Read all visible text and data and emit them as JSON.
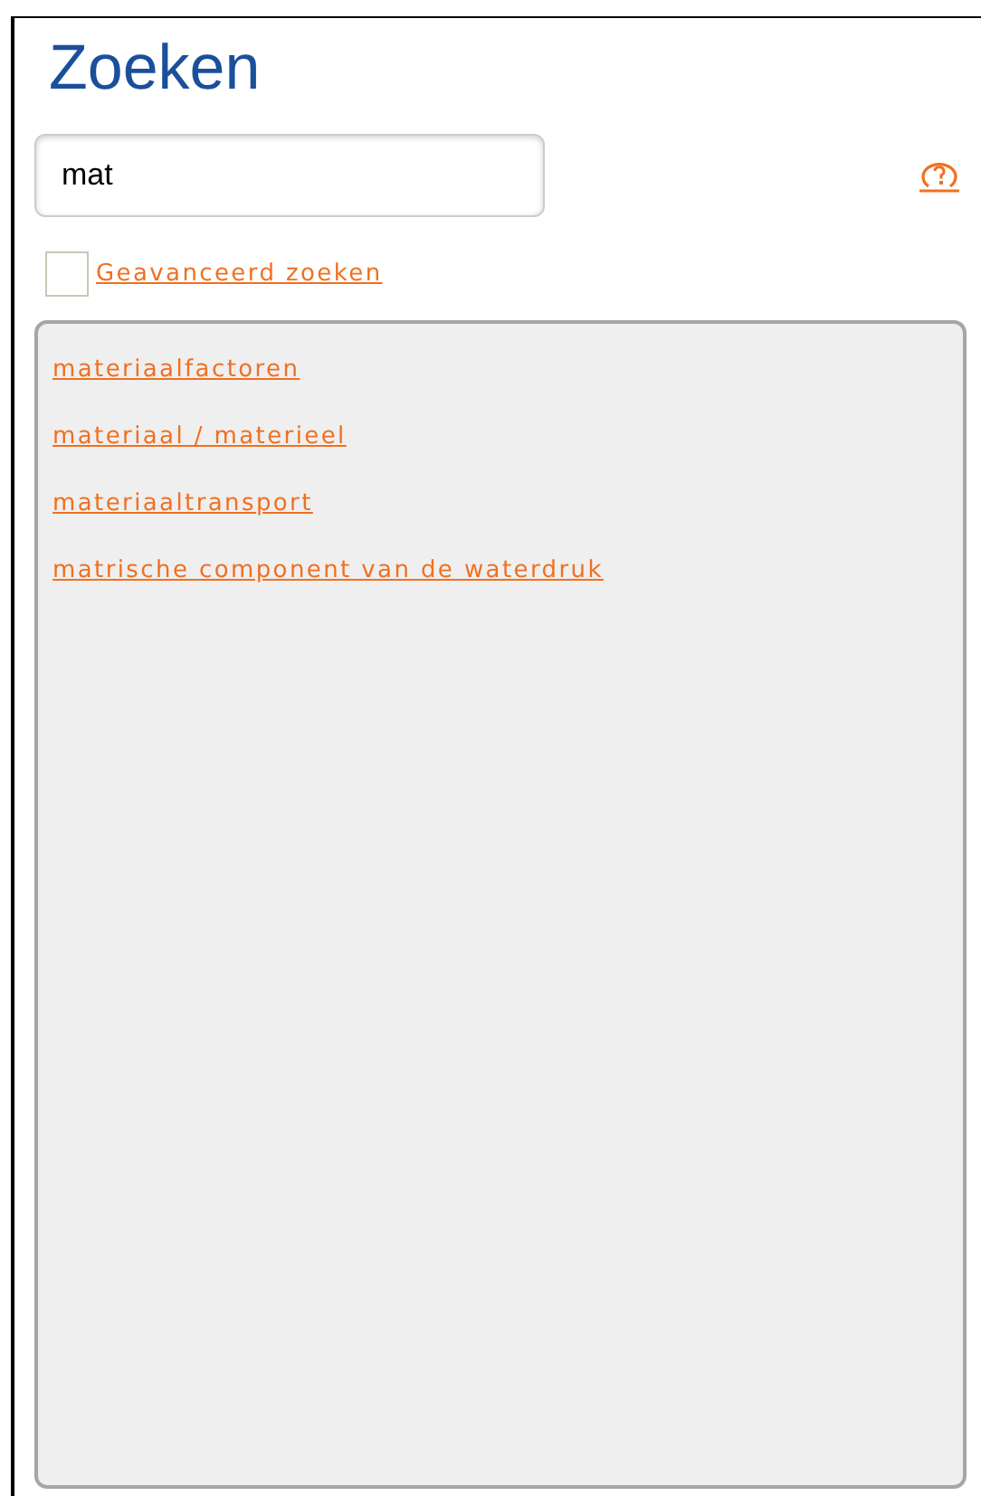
{
  "title": "Zoeken",
  "search": {
    "value": "mat"
  },
  "advanced": {
    "label": "Geavanceerd zoeken",
    "checked": false
  },
  "results": [
    {
      "label": "materiaalfactoren"
    },
    {
      "label": "materiaal / materieel"
    },
    {
      "label": "materiaaltransport"
    },
    {
      "label": "matrische component van de waterdruk"
    }
  ]
}
